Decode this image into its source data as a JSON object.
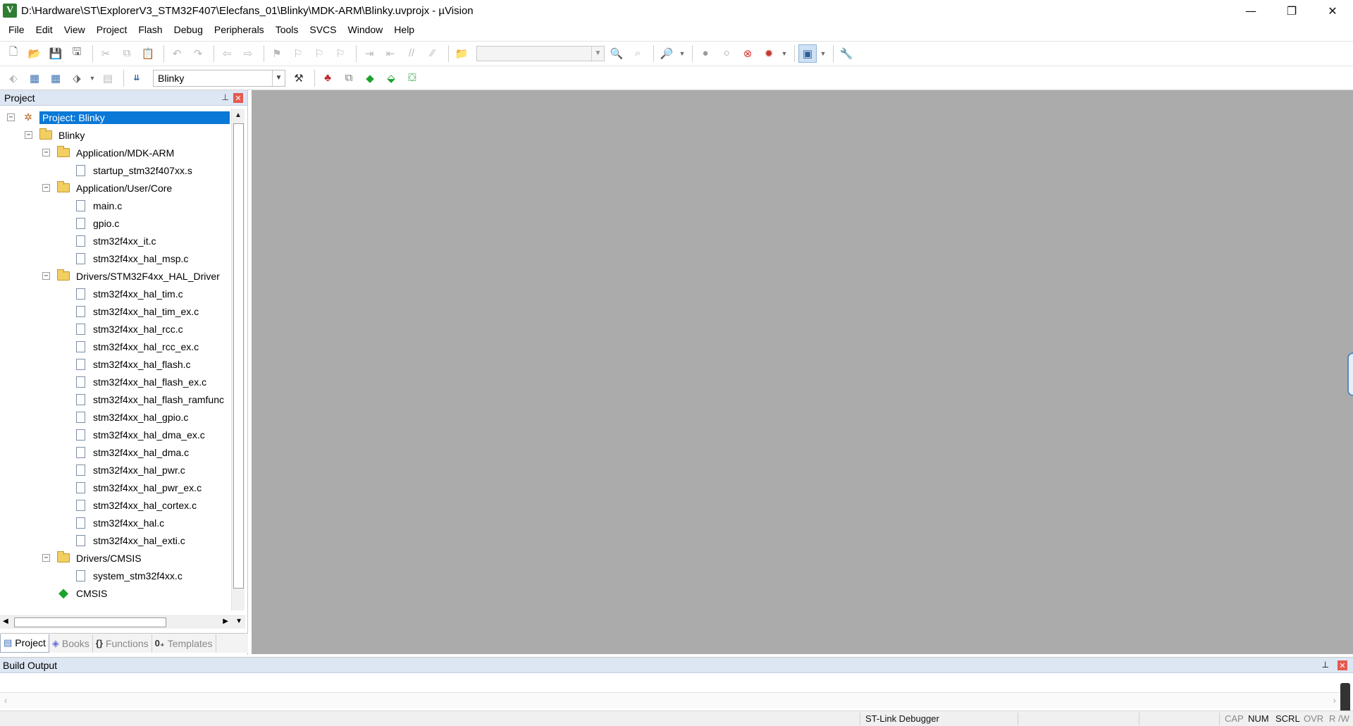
{
  "window": {
    "title": "D:\\Hardware\\ST\\ExplorerV3_STM32F407\\Elecfans_01\\Blinky\\MDK-ARM\\Blinky.uvprojx - µVision",
    "app_icon_letter": "V",
    "minimize": "—",
    "maximize": "❐",
    "close": "✕"
  },
  "menu": [
    "File",
    "Edit",
    "View",
    "Project",
    "Flash",
    "Debug",
    "Peripherals",
    "Tools",
    "SVCS",
    "Window",
    "Help"
  ],
  "toolbar2": {
    "target": "Blinky"
  },
  "project_panel": {
    "title": "Project",
    "pin": "📌",
    "close": "✕",
    "tree": [
      {
        "label": "Project: Blinky",
        "type": "project",
        "level": 0,
        "expander": "−",
        "selected": true
      },
      {
        "label": "Blinky",
        "type": "target",
        "level": 1,
        "expander": "−"
      },
      {
        "label": "Application/MDK-ARM",
        "type": "folder",
        "level": 2,
        "expander": "−"
      },
      {
        "label": "startup_stm32f407xx.s",
        "type": "file",
        "level": 3
      },
      {
        "label": "Application/User/Core",
        "type": "folder",
        "level": 2,
        "expander": "−"
      },
      {
        "label": "main.c",
        "type": "file",
        "level": 3
      },
      {
        "label": "gpio.c",
        "type": "file",
        "level": 3
      },
      {
        "label": "stm32f4xx_it.c",
        "type": "file",
        "level": 3
      },
      {
        "label": "stm32f4xx_hal_msp.c",
        "type": "file",
        "level": 3
      },
      {
        "label": "Drivers/STM32F4xx_HAL_Driver",
        "type": "folder",
        "level": 2,
        "expander": "−"
      },
      {
        "label": "stm32f4xx_hal_tim.c",
        "type": "file",
        "level": 3
      },
      {
        "label": "stm32f4xx_hal_tim_ex.c",
        "type": "file",
        "level": 3
      },
      {
        "label": "stm32f4xx_hal_rcc.c",
        "type": "file",
        "level": 3
      },
      {
        "label": "stm32f4xx_hal_rcc_ex.c",
        "type": "file",
        "level": 3
      },
      {
        "label": "stm32f4xx_hal_flash.c",
        "type": "file",
        "level": 3
      },
      {
        "label": "stm32f4xx_hal_flash_ex.c",
        "type": "file",
        "level": 3
      },
      {
        "label": "stm32f4xx_hal_flash_ramfunc",
        "type": "file",
        "level": 3
      },
      {
        "label": "stm32f4xx_hal_gpio.c",
        "type": "file",
        "level": 3
      },
      {
        "label": "stm32f4xx_hal_dma_ex.c",
        "type": "file",
        "level": 3
      },
      {
        "label": "stm32f4xx_hal_dma.c",
        "type": "file",
        "level": 3
      },
      {
        "label": "stm32f4xx_hal_pwr.c",
        "type": "file",
        "level": 3
      },
      {
        "label": "stm32f4xx_hal_pwr_ex.c",
        "type": "file",
        "level": 3
      },
      {
        "label": "stm32f4xx_hal_cortex.c",
        "type": "file",
        "level": 3
      },
      {
        "label": "stm32f4xx_hal.c",
        "type": "file",
        "level": 3
      },
      {
        "label": "stm32f4xx_hal_exti.c",
        "type": "file",
        "level": 3
      },
      {
        "label": "Drivers/CMSIS",
        "type": "folder",
        "level": 2,
        "expander": "−"
      },
      {
        "label": "system_stm32f4xx.c",
        "type": "file",
        "level": 3
      },
      {
        "label": "CMSIS",
        "type": "component",
        "level": 2
      }
    ],
    "tabs": [
      {
        "label": "Project",
        "icon": "project-tab-icon",
        "glyph": "▤",
        "active": true
      },
      {
        "label": "Books",
        "icon": "books-tab-icon",
        "glyph": "◈",
        "active": false
      },
      {
        "label": "Functions",
        "icon": "functions-tab-icon",
        "glyph": "{}",
        "active": false
      },
      {
        "label": "Templates",
        "icon": "templates-tab-icon",
        "glyph": "0₊",
        "active": false
      }
    ]
  },
  "build_output": {
    "title": "Build Output",
    "pin": "📌",
    "close": "✕"
  },
  "statusbar": {
    "debugger": "ST-Link Debugger",
    "indicators": [
      {
        "label": "CAP",
        "on": false
      },
      {
        "label": "NUM",
        "on": true
      },
      {
        "label": "SCRL",
        "on": true
      },
      {
        "label": "OVR",
        "on": false
      },
      {
        "label": "R /W",
        "on": false
      }
    ]
  },
  "colors": {
    "selection": "#0a78d7",
    "panel_header": "#dde6f3",
    "editor_background": "#ababab",
    "folder": "#f2cf62",
    "cmsis_green": "#1aa32a"
  }
}
